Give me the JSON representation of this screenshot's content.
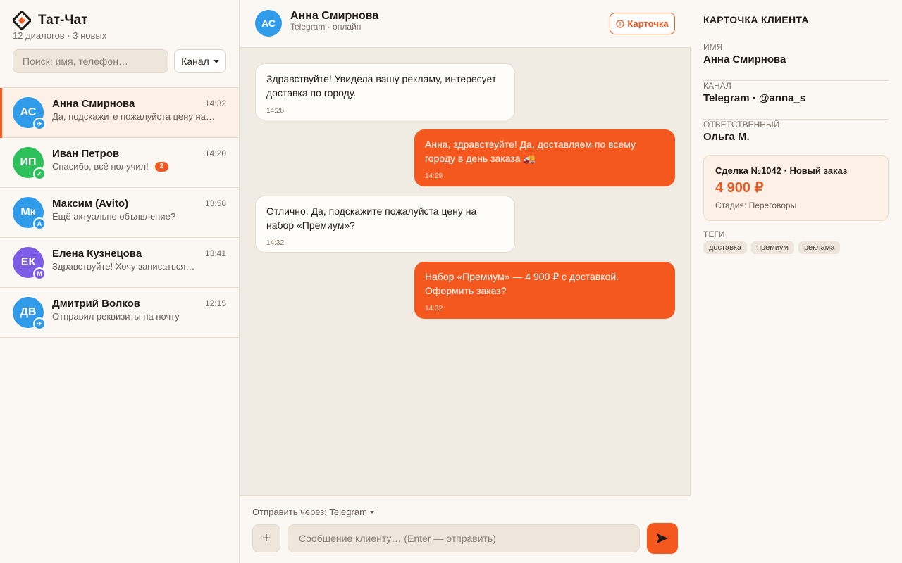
{
  "sidebar": {
    "app_name": "Тат-Чат",
    "subtitle": "12 диалогов · 3 новых",
    "search_placeholder": "Поиск: имя, телефон…",
    "channel_filter": "Канал",
    "dialogs": [
      {
        "initials": "АС",
        "name": "Анна Смирнова",
        "time": "14:32",
        "preview": "Да, подскажите пожалуйста цену на…",
        "avatar_color": "#2f9be9",
        "channel": "telegram",
        "channel_glyph": "✈",
        "channel_color": "#2f9be9",
        "unread": "",
        "active": true
      },
      {
        "initials": "ИП",
        "name": "Иван Петров",
        "time": "14:20",
        "preview": "Спасибо, всё получил!",
        "avatar_color": "#2ec05b",
        "channel": "whatsapp",
        "channel_glyph": "✓",
        "channel_color": "#2ec05b",
        "unread": "2",
        "active": false
      },
      {
        "initials": "Мк",
        "name": "Максим (Avito)",
        "time": "13:58",
        "preview": "Ещё актуально объявление?",
        "avatar_color": "#2f9be9",
        "channel": "avito",
        "channel_glyph": "A",
        "channel_color": "#2f9be9",
        "unread": "",
        "active": false
      },
      {
        "initials": "ЕК",
        "name": "Елена Кузнецова",
        "time": "13:41",
        "preview": "Здравствуйте! Хочу записаться…",
        "avatar_color": "#7d5ce6",
        "channel": "max",
        "channel_glyph": "M",
        "channel_color": "#7d5ce6",
        "unread": "",
        "active": false
      },
      {
        "initials": "ДВ",
        "name": "Дмитрий Волков",
        "time": "12:15",
        "preview": "Отправил реквизиты на почту",
        "avatar_color": "#2f9be9",
        "channel": "telegram",
        "channel_glyph": "✈",
        "channel_color": "#2f9be9",
        "unread": "",
        "active": false
      }
    ]
  },
  "chat": {
    "contact_initials": "АС",
    "contact_name": "Анна Смирнова",
    "contact_status": "Telegram · онлайн",
    "card_button": "Карточка",
    "messages": [
      {
        "direction": "in",
        "text": "Здравствуйте! Увидела вашу рекламу, интересует доставка по городу.",
        "time": "14:28"
      },
      {
        "direction": "out",
        "text": "Анна, здравствуйте! Да, доставляем по всему городу в день заказа 🚚",
        "time": "14:29"
      },
      {
        "direction": "in",
        "text": "Отлично. Да, подскажите пожалуйста цену на набор «Премиум»?",
        "time": "14:32"
      },
      {
        "direction": "out",
        "text": "Набор «Премиум» — 4 900 ₽ с доставкой. Оформить заказ?",
        "time": "14:32"
      }
    ],
    "send_via": "Отправить через: Telegram",
    "attach_label": "+",
    "input_placeholder": "Сообщение клиенту… (Enter — отправить)"
  },
  "card": {
    "title": "КАРТОЧКА КЛИЕНТА",
    "fields": [
      {
        "label": "ИМЯ",
        "value": "Анна Смирнова"
      },
      {
        "label": "КАНАЛ",
        "value": "Telegram · @anna_s"
      },
      {
        "label": "ОТВЕТСТВЕННЫЙ",
        "value": "Ольга М."
      }
    ],
    "deal": {
      "title": "Сделка №1042 · Новый заказ",
      "amount": "4 900 ₽",
      "stage": "Стадия: Переговоры"
    },
    "tags_label": "ТЕГИ",
    "tags": [
      "доставка",
      "премиум",
      "реклама"
    ]
  },
  "colors": {
    "accent": "#f4581f",
    "telegram": "#2f9be9",
    "whatsapp": "#2ec05b",
    "max": "#7d5ce6"
  }
}
